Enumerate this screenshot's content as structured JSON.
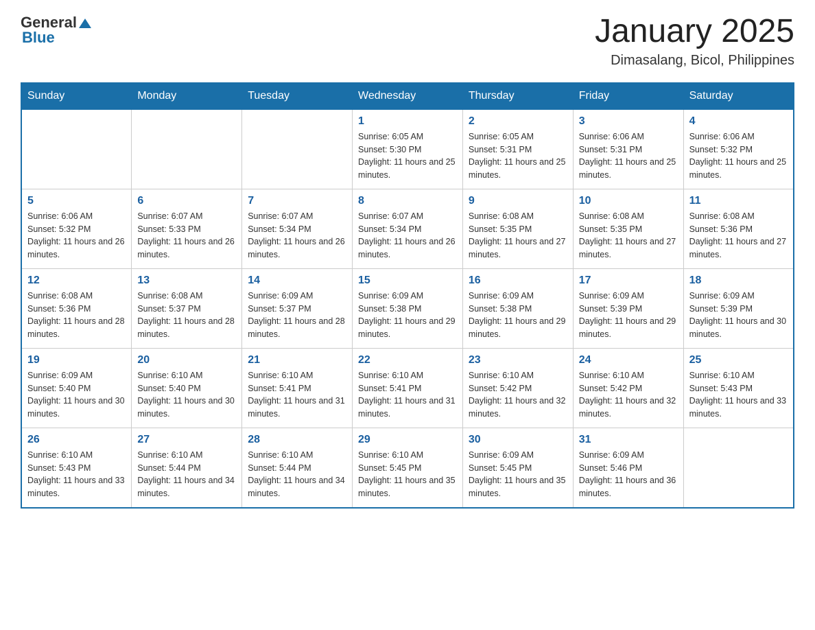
{
  "header": {
    "logo": {
      "text_general": "General",
      "text_blue": "Blue",
      "triangle_label": "logo-triangle"
    },
    "title": "January 2025",
    "location": "Dimasalang, Bicol, Philippines"
  },
  "calendar": {
    "headers": [
      "Sunday",
      "Monday",
      "Tuesday",
      "Wednesday",
      "Thursday",
      "Friday",
      "Saturday"
    ],
    "weeks": [
      [
        {
          "day": "",
          "sunrise": "",
          "sunset": "",
          "daylight": ""
        },
        {
          "day": "",
          "sunrise": "",
          "sunset": "",
          "daylight": ""
        },
        {
          "day": "",
          "sunrise": "",
          "sunset": "",
          "daylight": ""
        },
        {
          "day": "1",
          "sunrise": "Sunrise: 6:05 AM",
          "sunset": "Sunset: 5:30 PM",
          "daylight": "Daylight: 11 hours and 25 minutes."
        },
        {
          "day": "2",
          "sunrise": "Sunrise: 6:05 AM",
          "sunset": "Sunset: 5:31 PM",
          "daylight": "Daylight: 11 hours and 25 minutes."
        },
        {
          "day": "3",
          "sunrise": "Sunrise: 6:06 AM",
          "sunset": "Sunset: 5:31 PM",
          "daylight": "Daylight: 11 hours and 25 minutes."
        },
        {
          "day": "4",
          "sunrise": "Sunrise: 6:06 AM",
          "sunset": "Sunset: 5:32 PM",
          "daylight": "Daylight: 11 hours and 25 minutes."
        }
      ],
      [
        {
          "day": "5",
          "sunrise": "Sunrise: 6:06 AM",
          "sunset": "Sunset: 5:32 PM",
          "daylight": "Daylight: 11 hours and 26 minutes."
        },
        {
          "day": "6",
          "sunrise": "Sunrise: 6:07 AM",
          "sunset": "Sunset: 5:33 PM",
          "daylight": "Daylight: 11 hours and 26 minutes."
        },
        {
          "day": "7",
          "sunrise": "Sunrise: 6:07 AM",
          "sunset": "Sunset: 5:34 PM",
          "daylight": "Daylight: 11 hours and 26 minutes."
        },
        {
          "day": "8",
          "sunrise": "Sunrise: 6:07 AM",
          "sunset": "Sunset: 5:34 PM",
          "daylight": "Daylight: 11 hours and 26 minutes."
        },
        {
          "day": "9",
          "sunrise": "Sunrise: 6:08 AM",
          "sunset": "Sunset: 5:35 PM",
          "daylight": "Daylight: 11 hours and 27 minutes."
        },
        {
          "day": "10",
          "sunrise": "Sunrise: 6:08 AM",
          "sunset": "Sunset: 5:35 PM",
          "daylight": "Daylight: 11 hours and 27 minutes."
        },
        {
          "day": "11",
          "sunrise": "Sunrise: 6:08 AM",
          "sunset": "Sunset: 5:36 PM",
          "daylight": "Daylight: 11 hours and 27 minutes."
        }
      ],
      [
        {
          "day": "12",
          "sunrise": "Sunrise: 6:08 AM",
          "sunset": "Sunset: 5:36 PM",
          "daylight": "Daylight: 11 hours and 28 minutes."
        },
        {
          "day": "13",
          "sunrise": "Sunrise: 6:08 AM",
          "sunset": "Sunset: 5:37 PM",
          "daylight": "Daylight: 11 hours and 28 minutes."
        },
        {
          "day": "14",
          "sunrise": "Sunrise: 6:09 AM",
          "sunset": "Sunset: 5:37 PM",
          "daylight": "Daylight: 11 hours and 28 minutes."
        },
        {
          "day": "15",
          "sunrise": "Sunrise: 6:09 AM",
          "sunset": "Sunset: 5:38 PM",
          "daylight": "Daylight: 11 hours and 29 minutes."
        },
        {
          "day": "16",
          "sunrise": "Sunrise: 6:09 AM",
          "sunset": "Sunset: 5:38 PM",
          "daylight": "Daylight: 11 hours and 29 minutes."
        },
        {
          "day": "17",
          "sunrise": "Sunrise: 6:09 AM",
          "sunset": "Sunset: 5:39 PM",
          "daylight": "Daylight: 11 hours and 29 minutes."
        },
        {
          "day": "18",
          "sunrise": "Sunrise: 6:09 AM",
          "sunset": "Sunset: 5:39 PM",
          "daylight": "Daylight: 11 hours and 30 minutes."
        }
      ],
      [
        {
          "day": "19",
          "sunrise": "Sunrise: 6:09 AM",
          "sunset": "Sunset: 5:40 PM",
          "daylight": "Daylight: 11 hours and 30 minutes."
        },
        {
          "day": "20",
          "sunrise": "Sunrise: 6:10 AM",
          "sunset": "Sunset: 5:40 PM",
          "daylight": "Daylight: 11 hours and 30 minutes."
        },
        {
          "day": "21",
          "sunrise": "Sunrise: 6:10 AM",
          "sunset": "Sunset: 5:41 PM",
          "daylight": "Daylight: 11 hours and 31 minutes."
        },
        {
          "day": "22",
          "sunrise": "Sunrise: 6:10 AM",
          "sunset": "Sunset: 5:41 PM",
          "daylight": "Daylight: 11 hours and 31 minutes."
        },
        {
          "day": "23",
          "sunrise": "Sunrise: 6:10 AM",
          "sunset": "Sunset: 5:42 PM",
          "daylight": "Daylight: 11 hours and 32 minutes."
        },
        {
          "day": "24",
          "sunrise": "Sunrise: 6:10 AM",
          "sunset": "Sunset: 5:42 PM",
          "daylight": "Daylight: 11 hours and 32 minutes."
        },
        {
          "day": "25",
          "sunrise": "Sunrise: 6:10 AM",
          "sunset": "Sunset: 5:43 PM",
          "daylight": "Daylight: 11 hours and 33 minutes."
        }
      ],
      [
        {
          "day": "26",
          "sunrise": "Sunrise: 6:10 AM",
          "sunset": "Sunset: 5:43 PM",
          "daylight": "Daylight: 11 hours and 33 minutes."
        },
        {
          "day": "27",
          "sunrise": "Sunrise: 6:10 AM",
          "sunset": "Sunset: 5:44 PM",
          "daylight": "Daylight: 11 hours and 34 minutes."
        },
        {
          "day": "28",
          "sunrise": "Sunrise: 6:10 AM",
          "sunset": "Sunset: 5:44 PM",
          "daylight": "Daylight: 11 hours and 34 minutes."
        },
        {
          "day": "29",
          "sunrise": "Sunrise: 6:10 AM",
          "sunset": "Sunset: 5:45 PM",
          "daylight": "Daylight: 11 hours and 35 minutes."
        },
        {
          "day": "30",
          "sunrise": "Sunrise: 6:09 AM",
          "sunset": "Sunset: 5:45 PM",
          "daylight": "Daylight: 11 hours and 35 minutes."
        },
        {
          "day": "31",
          "sunrise": "Sunrise: 6:09 AM",
          "sunset": "Sunset: 5:46 PM",
          "daylight": "Daylight: 11 hours and 36 minutes."
        },
        {
          "day": "",
          "sunrise": "",
          "sunset": "",
          "daylight": ""
        }
      ]
    ]
  }
}
